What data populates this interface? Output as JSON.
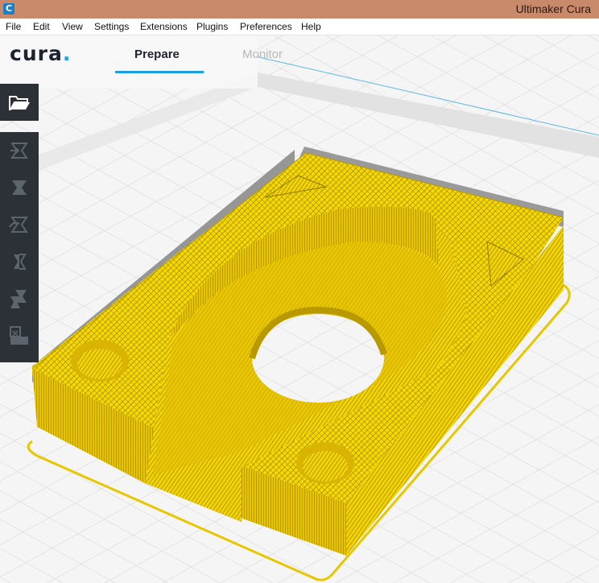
{
  "window": {
    "title": "Ultimaker Cura",
    "app_icon_glyph": "C"
  },
  "menu": [
    "File",
    "Edit",
    "View",
    "Settings",
    "Extensions",
    "Plugins",
    "Preferences",
    "Help"
  ],
  "header": {
    "logo_text": "cura",
    "logo_dot": ".",
    "tabs": [
      {
        "label": "Prepare",
        "active": true
      },
      {
        "label": "Monitor",
        "active": false
      }
    ]
  },
  "toolbar": {
    "open_icon": "folder-open-icon",
    "tools": [
      "translate-tool-icon",
      "scale-tool-icon",
      "rotate-tool-icon",
      "mirror-tool-icon",
      "per-model-settings-icon",
      "support-blocker-icon"
    ]
  },
  "colors": {
    "model_yellow": "#f2d200",
    "toolbar_bg": "#2b3137",
    "accent_blue": "#1b9fe0",
    "titlebar": "#c98a6c"
  }
}
